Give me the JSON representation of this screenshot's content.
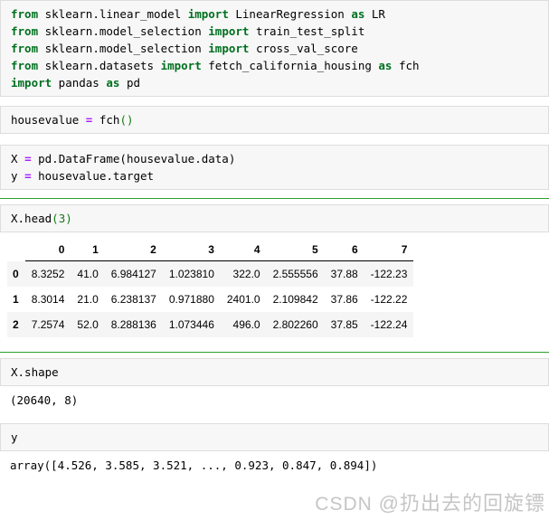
{
  "cells": [
    {
      "name": "imports",
      "separator_above": false,
      "type": "code",
      "lines": [
        [
          {
            "t": "from",
            "c": "k"
          },
          {
            "t": " sklearn.linear_model ",
            "c": ""
          },
          {
            "t": "import",
            "c": "k"
          },
          {
            "t": " LinearRegression ",
            "c": ""
          },
          {
            "t": "as",
            "c": "k"
          },
          {
            "t": " LR",
            "c": ""
          }
        ],
        [
          {
            "t": "from",
            "c": "k"
          },
          {
            "t": " sklearn.model_selection ",
            "c": ""
          },
          {
            "t": "import",
            "c": "k"
          },
          {
            "t": " train_test_split",
            "c": ""
          }
        ],
        [
          {
            "t": "from",
            "c": "k"
          },
          {
            "t": " sklearn.model_selection ",
            "c": ""
          },
          {
            "t": "import",
            "c": "k"
          },
          {
            "t": " cross_val_score",
            "c": ""
          }
        ],
        [
          {
            "t": "from",
            "c": "k"
          },
          {
            "t": " sklearn.datasets ",
            "c": ""
          },
          {
            "t": "import",
            "c": "k"
          },
          {
            "t": " fetch_california_housing ",
            "c": ""
          },
          {
            "t": "as",
            "c": "k"
          },
          {
            "t": " fch",
            "c": ""
          }
        ],
        [
          {
            "t": "import",
            "c": "k"
          },
          {
            "t": " pandas ",
            "c": ""
          },
          {
            "t": "as",
            "c": "k"
          },
          {
            "t": " pd",
            "c": ""
          }
        ]
      ],
      "plain": "from sklearn.linear_model import LinearRegression as LR\nfrom sklearn.model_selection import train_test_split\nfrom sklearn.model_selection import cross_val_score\nfrom sklearn.datasets import fetch_california_housing as fch\nimport pandas as pd"
    },
    {
      "name": "load-dataset",
      "separator_above": false,
      "type": "code",
      "lines": [
        [
          {
            "t": "housevalue ",
            "c": ""
          },
          {
            "t": "=",
            "c": "op"
          },
          {
            "t": " fch",
            "c": ""
          },
          {
            "t": "()",
            "c": "p"
          }
        ]
      ],
      "plain": "housevalue = fch()"
    },
    {
      "name": "build-xy",
      "separator_above": false,
      "type": "code",
      "lines": [
        [
          {
            "t": "X ",
            "c": ""
          },
          {
            "t": "=",
            "c": "op"
          },
          {
            "t": " pd.DataFrame(housevalue.data)",
            "c": ""
          }
        ],
        [
          {
            "t": "y ",
            "c": ""
          },
          {
            "t": "=",
            "c": "op"
          },
          {
            "t": " housevalue.target",
            "c": ""
          }
        ]
      ],
      "plain": "X = pd.DataFrame(housevalue.data)\ny = housevalue.target"
    },
    {
      "name": "x-head",
      "separator_above": true,
      "type": "code",
      "lines": [
        [
          {
            "t": "X.head",
            "c": ""
          },
          {
            "t": "(",
            "c": "p"
          },
          {
            "t": "3",
            "c": "n"
          },
          {
            "t": ")",
            "c": "p"
          }
        ]
      ],
      "plain": "X.head(3)"
    },
    {
      "name": "x-shape",
      "separator_above": true,
      "type": "code",
      "lines": [
        [
          {
            "t": "X.shape",
            "c": ""
          }
        ]
      ],
      "plain": "X.shape"
    },
    {
      "name": "y-view",
      "separator_above": false,
      "type": "code",
      "lines": [
        [
          {
            "t": "y",
            "c": ""
          }
        ]
      ],
      "plain": "y"
    }
  ],
  "table_output": {
    "columns": [
      "0",
      "1",
      "2",
      "3",
      "4",
      "5",
      "6",
      "7"
    ],
    "index": [
      "0",
      "1",
      "2"
    ],
    "rows": [
      [
        "8.3252",
        "41.0",
        "6.984127",
        "1.023810",
        "322.0",
        "2.555556",
        "37.88",
        "-122.23"
      ],
      [
        "8.3014",
        "21.0",
        "6.238137",
        "0.971880",
        "2401.0",
        "2.109842",
        "37.86",
        "-122.22"
      ],
      [
        "7.2574",
        "52.0",
        "8.288136",
        "1.073446",
        "496.0",
        "2.802260",
        "37.85",
        "-122.24"
      ]
    ]
  },
  "shape_output": "(20640, 8)",
  "array_output": "array([4.526, 3.585, 3.521, ..., 0.923, 0.847, 0.894])",
  "watermark": {
    "brand": "CSDN",
    "handle": "@扔出去的回旋镖"
  },
  "colors": {
    "keyword": "#007020",
    "operator": "#aa22ff",
    "punctuation": "#0c7d0c",
    "number": "#207020",
    "cell_background": "#f7f7f7",
    "cell_border": "#dddddd",
    "separator": "#2ca02c",
    "table_stripe": "#f5f5f5",
    "text": "#000000"
  }
}
